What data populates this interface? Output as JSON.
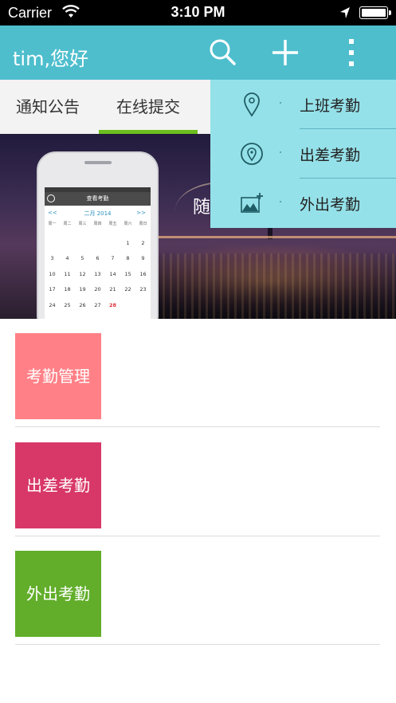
{
  "status_bar": {
    "carrier": "Carrier",
    "time": "3:10 PM"
  },
  "header": {
    "greeting": "tim,您好"
  },
  "tabs": [
    {
      "label": "通知公告",
      "active": false
    },
    {
      "label": "在线提交",
      "active": true
    }
  ],
  "banner": {
    "caption": "随",
    "phone": {
      "nav_title": "查看考勤",
      "month_title": "二月 2014",
      "prev": "<<",
      "next": ">>",
      "weekdays": [
        "周一",
        "周二",
        "周三",
        "周四",
        "周五",
        "周六",
        "周日"
      ],
      "weeks": [
        [
          "",
          "",
          "",
          "",
          "",
          "1",
          "2"
        ],
        [
          "3",
          "4",
          "5",
          "6",
          "7",
          "8",
          "9"
        ],
        [
          "10",
          "11",
          "12",
          "13",
          "14",
          "15",
          "16"
        ],
        [
          "17",
          "18",
          "19",
          "20",
          "21",
          "22",
          "23"
        ],
        [
          "24",
          "25",
          "26",
          "27",
          "28",
          "",
          ""
        ]
      ],
      "highlight_day": "28"
    }
  },
  "dropdown": {
    "items": [
      {
        "label": "上班考勤",
        "icon": "location-pin-icon"
      },
      {
        "label": "出差考勤",
        "icon": "target-pin-icon"
      },
      {
        "label": "外出考勤",
        "icon": "add-photo-icon"
      }
    ]
  },
  "tiles": [
    {
      "label": "考勤管理",
      "color": "#ff8187"
    },
    {
      "label": "出差考勤",
      "color": "#d83868"
    },
    {
      "label": "外出考勤",
      "color": "#62ae2b"
    }
  ],
  "colors": {
    "header": "#4ebecd",
    "dropdown": "#95e1e9",
    "tab_indicator": "#6cbf1e"
  }
}
